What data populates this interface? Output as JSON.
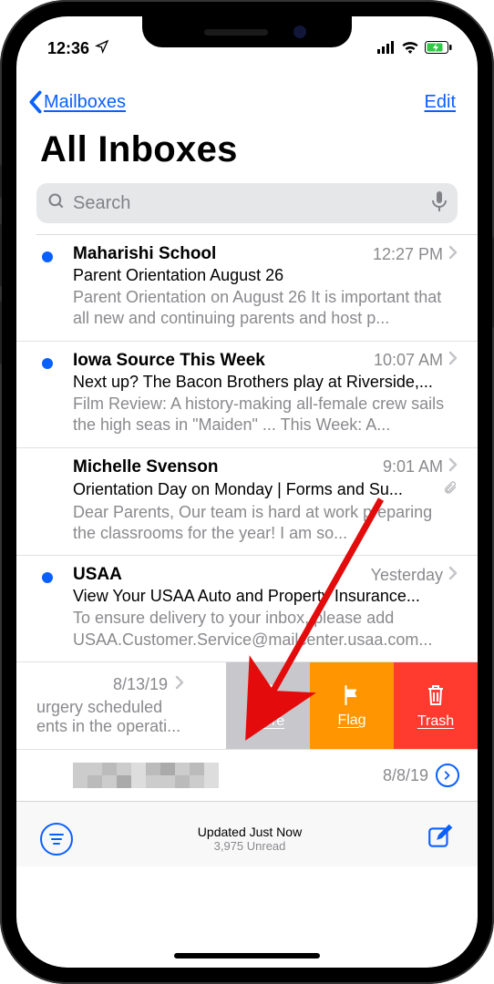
{
  "status": {
    "time": "12:36"
  },
  "nav": {
    "back": "Mailboxes",
    "edit": "Edit"
  },
  "title": "All Inboxes",
  "search": {
    "placeholder": "Search"
  },
  "emails": [
    {
      "unread": true,
      "sender": "Maharishi School",
      "time": "12:27 PM",
      "subject": "Parent Orientation August 26",
      "preview": "Parent Orientation on August 26 It is important that all new and continuing parents and host p...",
      "attachment": false
    },
    {
      "unread": true,
      "sender": "Iowa Source This Week",
      "time": "10:07 AM",
      "subject": "Next up? The Bacon Brothers play at Riverside,...",
      "preview": "Film Review: A history-making all-female crew sails the high seas in \"Maiden\" ... This Week: A...",
      "attachment": false
    },
    {
      "unread": false,
      "sender": "Michelle Svenson",
      "time": "9:01 AM",
      "subject": "Orientation Day on Monday | Forms and Su...",
      "preview": "Dear Parents, Our team is hard at work preparing the classrooms for the year! I am so...",
      "attachment": true
    },
    {
      "unread": true,
      "sender": "USAA",
      "time": "Yesterday",
      "subject": "View Your USAA Auto and Property Insurance...",
      "preview": "To ensure delivery to your inbox, please add USAA.Customer.Service@mailcenter.usaa.com...",
      "attachment": false
    }
  ],
  "swipe": {
    "date": "8/13/19",
    "line1": "urgery scheduled",
    "line2": "ents in the operati...",
    "more": "More",
    "flag": "Flag",
    "trash": "Trash"
  },
  "blurred": {
    "date": "8/8/19"
  },
  "toolbar": {
    "updated": "Updated Just Now",
    "unread": "3,975 Unread"
  }
}
